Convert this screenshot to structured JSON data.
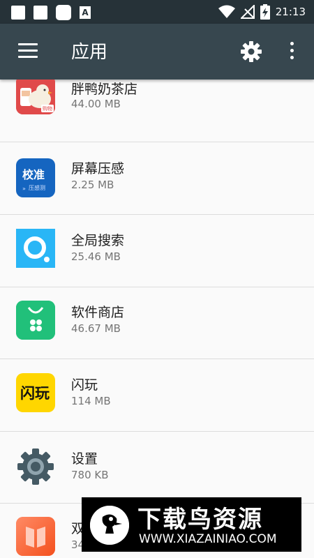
{
  "status_bar": {
    "time": "21:13",
    "notification_icons": [
      "square-icon",
      "square-icon",
      "rounded-square-icon",
      "a-icon"
    ],
    "a_icon_text": "A",
    "right_icons": [
      "wifi-icon",
      "signal-off-icon",
      "battery-charging-icon"
    ]
  },
  "toolbar": {
    "title": "应用",
    "menu_icon": "hamburger-menu-icon",
    "settings_icon": "gear-icon",
    "more_icon": "more-vert-icon"
  },
  "apps": [
    {
      "name": "胖鸭奶茶店",
      "size": "44.00 MB",
      "icon": "duck-milk-tea-icon",
      "icon_text": "购物"
    },
    {
      "name": "屏幕压感",
      "size": "2.25 MB",
      "icon": "calibrate-icon",
      "icon_text": "校准",
      "icon_subtext": "压感测"
    },
    {
      "name": "全局搜索",
      "size": "25.46 MB",
      "icon": "search-ring-icon"
    },
    {
      "name": "软件商店",
      "size": "46.67 MB",
      "icon": "software-store-icon"
    },
    {
      "name": "闪玩",
      "size": "114 MB",
      "icon": "shanwan-icon",
      "icon_text": "闪玩"
    },
    {
      "name": "设置",
      "size": "780 KB",
      "icon": "settings-gear-icon"
    },
    {
      "name": "双",
      "size": "34",
      "icon": "book-icon"
    }
  ],
  "watermark": {
    "title": "下载鸟资源",
    "url": "WWW.XIAZAINIAO.COM"
  },
  "colors": {
    "status_bar": "#263238",
    "toolbar": "#37474f",
    "background": "#fafafa",
    "divider": "#dcdcdc"
  }
}
